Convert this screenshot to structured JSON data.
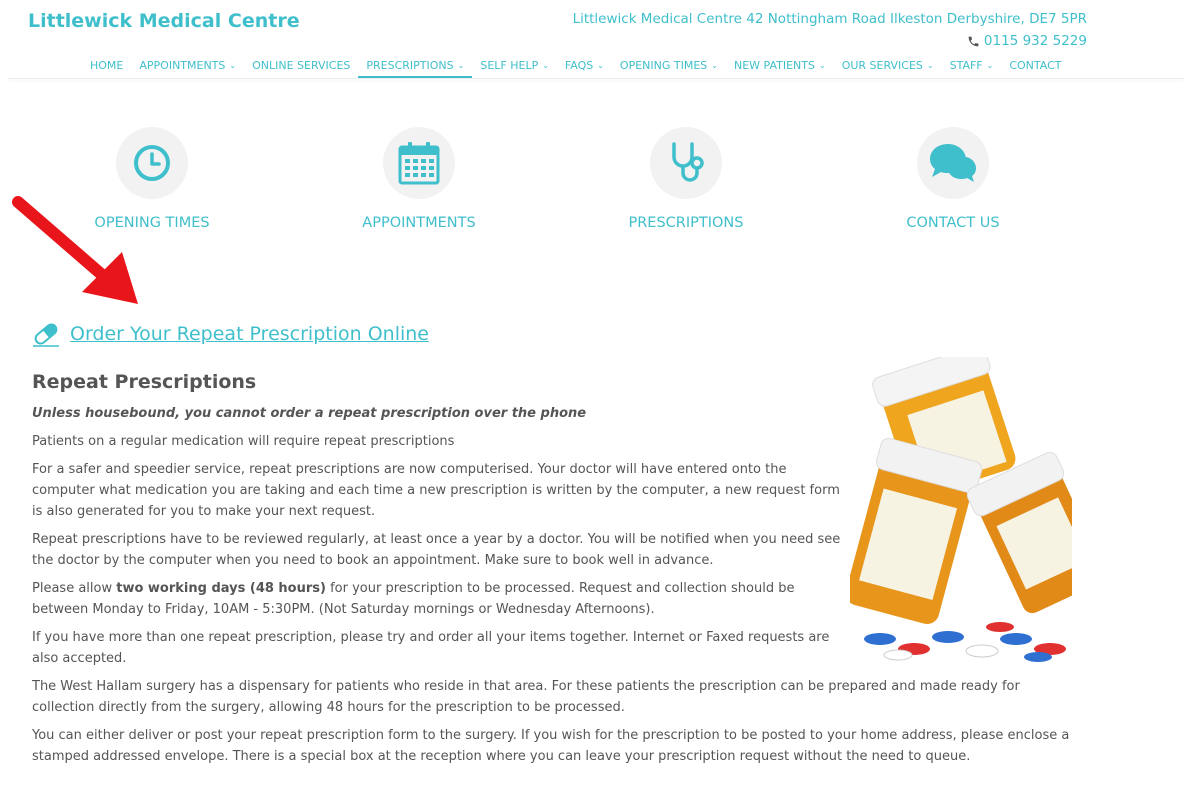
{
  "header": {
    "site_title": "Littlewick Medical Centre",
    "address": "Littlewick Medical Centre 42 Nottingham Road Ilkeston Derbyshire, DE7 5PR",
    "phone": "0115 932 5229"
  },
  "nav": [
    {
      "label": "HOME"
    },
    {
      "label": "APPOINTMENTS",
      "dropdown": true
    },
    {
      "label": "ONLINE SERVICES"
    },
    {
      "label": "PRESCRIPTIONS",
      "dropdown": true,
      "active": true
    },
    {
      "label": "SELF HELP",
      "dropdown": true
    },
    {
      "label": "FAQS",
      "dropdown": true
    },
    {
      "label": "OPENING TIMES",
      "dropdown": true
    },
    {
      "label": "NEW PATIENTS",
      "dropdown": true
    },
    {
      "label": "OUR SERVICES",
      "dropdown": true
    },
    {
      "label": "STAFF",
      "dropdown": true
    },
    {
      "label": "CONTACT"
    }
  ],
  "quick_links": [
    {
      "label": "OPENING TIMES",
      "icon": "clock-icon"
    },
    {
      "label": "APPOINTMENTS",
      "icon": "calendar-icon"
    },
    {
      "label": "PRESCRIPTIONS",
      "icon": "stethoscope-icon"
    },
    {
      "label": "CONTACT US",
      "icon": "chat-bubbles-icon"
    }
  ],
  "order_link": {
    "label": "Order Your Repeat Prescription Online",
    "icon": "pill-icon"
  },
  "content": {
    "heading": "Repeat Prescriptions",
    "lead": "Unless housebound, you cannot order a repeat prescription over the phone",
    "p1": "Patients on a regular medication will require repeat prescriptions",
    "p2": "For a safer and speedier service, repeat prescriptions are now computerised. Your doctor will have entered onto the computer what medication you are taking and each time a new prescription is written by the computer, a new request form is also generated for you to make your next request.",
    "p3": "Repeat prescriptions have to be reviewed regularly, at least once a year by a doctor. You will be notified when you need see the doctor by the computer when you need to book an appointment. Make sure to book well in advance.",
    "p4_pre": "Please allow ",
    "p4_bold": "two working days (48 hours)",
    "p4_post": " for your prescription to be processed. Request and collection should be between Monday to Friday, 10AM - 5:30PM. (Not Saturday mornings or Wednesday Afternoons).",
    "p5": "If you have more than one repeat prescription, please try and order all your items together. Internet or Faxed requests are also accepted.",
    "p6": "The West Hallam surgery has a dispensary for patients who reside in that area. For these patients the prescription can be prepared and made ready for collection directly from the surgery, allowing 48 hours for the prescription to be processed.",
    "p7": "You can either deliver or post your repeat prescription form to the surgery. If you wish for the prescription to be posted to your home address, please enclose a stamped addressed envelope. There is a special box at the reception where you can leave your prescription request without the need to queue."
  },
  "colors": {
    "accent": "#3fbfcb",
    "text": "#555555",
    "arrow": "#e8151b"
  }
}
